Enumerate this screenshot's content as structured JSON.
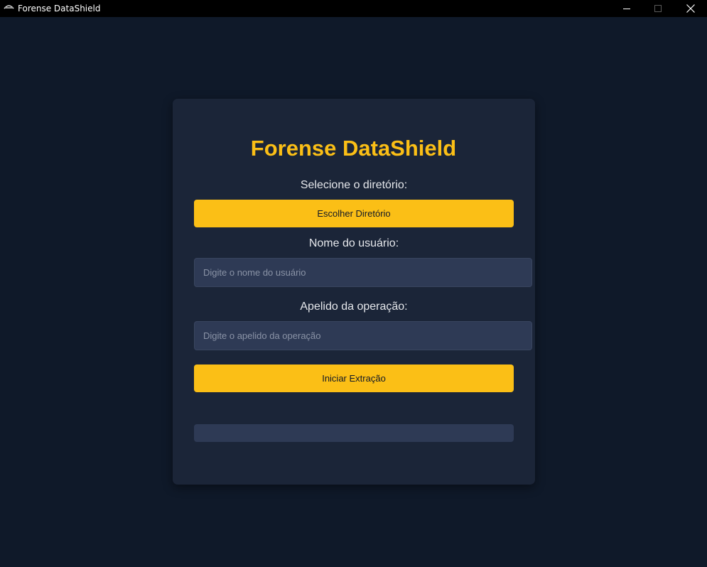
{
  "window": {
    "title": "Forense DataShield",
    "icon": "app-logo-icon",
    "controls": [
      "minimize-icon",
      "maximize-icon",
      "close-icon"
    ]
  },
  "form": {
    "title": "Forense DataShield",
    "directory_label": "Selecione o diretório:",
    "directory_button": "Escolher Diretório",
    "user_label": "Nome do usuário:",
    "user_value": "",
    "user_placeholder": "Digite o nome do usuário",
    "operation_label": "Apelido da operação:",
    "operation_value": "",
    "operation_placeholder": "Digite o apelido da operação",
    "start_button": "Iniciar Extração",
    "progress": 0
  },
  "colors": {
    "background": "#0f1929",
    "card": "#1b2538",
    "accent": "#fbbf16",
    "input_background": "#2e3a55",
    "label_text": "#e5e7eb",
    "titlebar": "#000000"
  }
}
